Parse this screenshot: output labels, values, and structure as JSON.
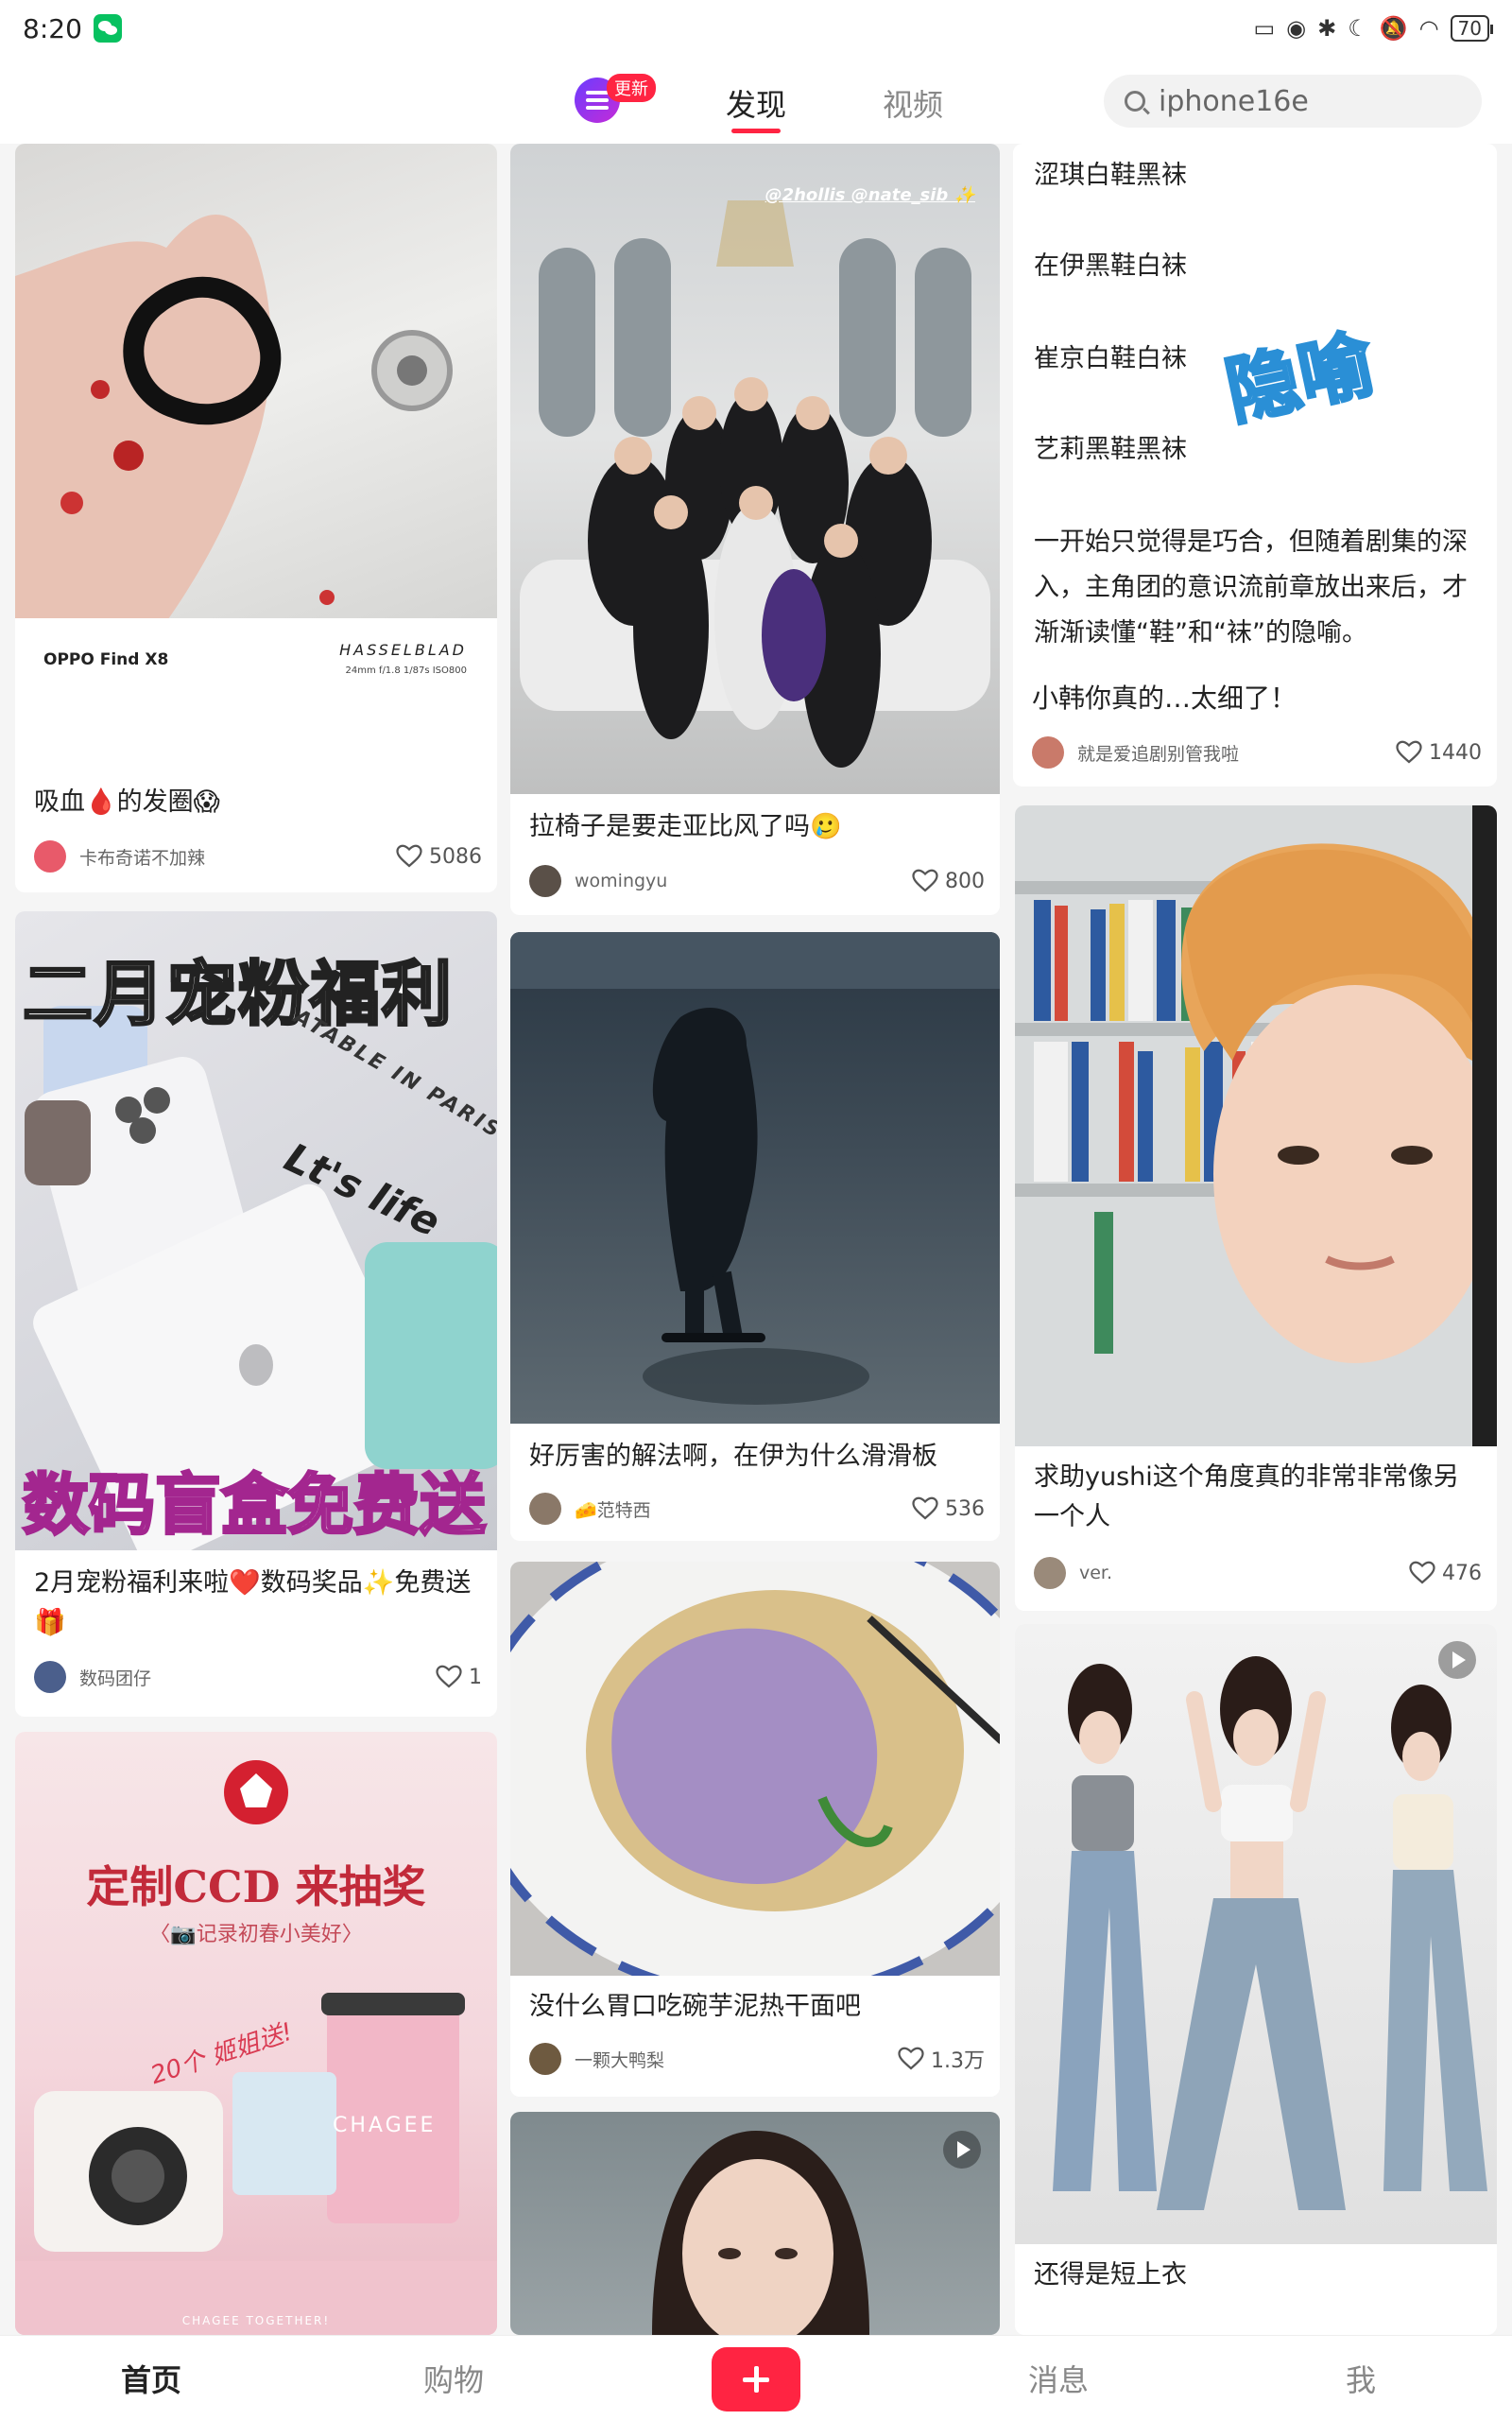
{
  "status_bar": {
    "time": "8:20",
    "battery": "70"
  },
  "top_nav": {
    "update_badge": "更新",
    "tabs": [
      {
        "label": "发现"
      },
      {
        "label": "视频"
      }
    ],
    "search": {
      "value": "iphone16e"
    }
  },
  "feed": {
    "col1": [
      {
        "title": "吸血🩸的发圈😱",
        "author": "卡布奇诺不加辣",
        "likes": "5086",
        "photo_caption": "OPPO Find X8",
        "photo_brand": "HASSELBLAD",
        "photo_specs": "24mm f/1.8 1/87s ISO800"
      },
      {
        "title": "2月宠粉福利来啦❤️数码奖品✨免费送🎁",
        "author": "数码团仔",
        "likes": "1",
        "overlay_top": "二月宠粉福利",
        "overlay_bottom": "数码盲盒免费送",
        "overlay_mid": "Lt's life",
        "overlay_side": "ATABLE IN PARIS"
      },
      {
        "overlay_title": "定制CCD 来抽奖",
        "overlay_sub": "〈📷记录初春小美好〉",
        "overlay_gift": "20个 姬姐送!",
        "overlay_brand": "CHAGEE",
        "overlay_footer": "CHAGEE TOGETHER!"
      }
    ],
    "col2": [
      {
        "title": "拉椅子是要走亚比风了吗🥲",
        "author": "womingyu",
        "likes": "800",
        "photo_tag": "@2hollis @nate_sib ✨"
      },
      {
        "title": "好厉害的解法啊，在伊为什么滑滑板",
        "author": "🧀范特西",
        "likes": "536"
      },
      {
        "title": "没什么胃口吃碗芋泥热干面吧",
        "author": "一颗大鸭梨",
        "likes": "1.3万"
      },
      {}
    ],
    "col3": [
      {
        "lines": [
          "涩琪白鞋黑袜",
          "在伊黑鞋白袜",
          "崔京白鞋白袜",
          "艺莉黑鞋黑袜"
        ],
        "sticker": "隐喻",
        "paragraph": "一开始只觉得是巧合，但随着剧集的深入，主角团的意识流前章放出来后，才渐渐读懂“鞋”和“袜”的隐喻。",
        "title": "小韩你真的…太细了！",
        "author": "就是爱追剧别管我啦",
        "likes": "1440"
      },
      {
        "title": "求助yushi这个角度真的非常非常像另一个人",
        "author": "ver.",
        "likes": "476"
      },
      {
        "title": "还得是短上衣"
      }
    ]
  },
  "bottom_nav": {
    "items": [
      {
        "label": "首页"
      },
      {
        "label": "购物"
      },
      {
        "label": "消息"
      },
      {
        "label": "我"
      }
    ]
  },
  "colors": {
    "accent": "#ff2442"
  }
}
